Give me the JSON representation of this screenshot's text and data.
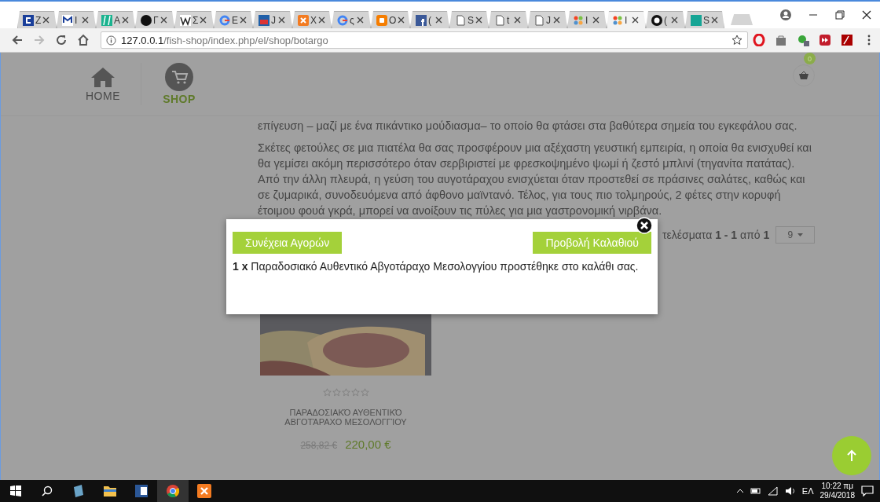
{
  "browser": {
    "tabs": [
      {
        "kind": "c",
        "title": "Ζ",
        "selected": false
      },
      {
        "kind": "m",
        "title": "Ι",
        "selected": false
      },
      {
        "kind": "bars",
        "title": "Α",
        "selected": false
      },
      {
        "kind": "dot",
        "title": "Γ",
        "selected": false
      },
      {
        "kind": "w",
        "title": "Σ",
        "selected": false
      },
      {
        "kind": "g",
        "title": "Ε",
        "selected": false
      },
      {
        "kind": "jnet",
        "title": "J",
        "selected": false
      },
      {
        "kind": "xampp",
        "title": "Χ",
        "selected": false
      },
      {
        "kind": "g",
        "title": "ς",
        "selected": false
      },
      {
        "kind": "blogger",
        "title": "Ο",
        "selected": false
      },
      {
        "kind": "facebook",
        "title": "(",
        "selected": false
      },
      {
        "kind": "doc",
        "title": "S",
        "selected": false
      },
      {
        "kind": "doc",
        "title": "t",
        "selected": false
      },
      {
        "kind": "doc",
        "title": "J",
        "selected": false
      },
      {
        "kind": "joomla",
        "title": "Ι",
        "selected": false
      },
      {
        "kind": "joomla",
        "title": "Ι",
        "selected": true
      },
      {
        "kind": "github",
        "title": "(",
        "selected": false
      },
      {
        "kind": "square",
        "title": "S",
        "selected": false
      }
    ],
    "address": {
      "host": "127.0.0.1",
      "path": "/fish-shop/index.php/el/shop/botargo"
    }
  },
  "nav": [
    {
      "label": "HOME",
      "kind": "home",
      "selected": false
    },
    {
      "label": "SHOP",
      "kind": "cart",
      "selected": true
    }
  ],
  "cart_count": "0",
  "description": [
    "επίγευση – μαζί με ένα πικάντικο μούδιασμα– το οποίο θα φτάσει στα βαθύτερα σημεία του εγκεφάλου σας.",
    "Σκέτες φετούλες σε μια πιατέλα θα σας προσφέρουν μια αξέχαστη γευστική εμπειρία, η οποία θα ενισχυθεί και θα γεμίσει ακόμη περισσότερο όταν σερβιριστεί με φρεσκοψημένο ψωμί ή ζεστό μπλινί (τηγανίτα πατάτας). Από την άλλη πλευρά, η γεύση του αυγοτάραχου ενισχύεται όταν προστεθεί σε πράσινες σαλάτες, καθώς και σε ζυμαρικά, συνοδευόμενα από άφθονο μαϊντανό. Τέλος, για τους πιο τολμηρούς, 2 φέτες στην κορυφή έτοιμου φουά γκρά, μπορεί να ανοίξουν τις πύλες για μια γαστρονομική νιρβάνα."
  ],
  "results": {
    "text": "τελέσματα **1 - 1** από **1**",
    "per_page": "9"
  },
  "product": {
    "name": "ΠΑΡΑΔΟΣΙΑΚΌ ΑΥΘΕΝΤΙΚΌ ΑΒΓΟΤΆΡΑΧΟ ΜΕΣΟΛΟΓΓΊΟΥ",
    "old_price": "258,82 €",
    "price": "220,00 €",
    "stars": 0
  },
  "dialog": {
    "continue_button": "Συνέχεια Αγορών",
    "cart_button": "Προβολή Καλαθιού",
    "message": "**1 x** Παραδοσιακό Αυθεντικό Αβγοτάραχο Μεσολογγίου προστέθηκε στο καλάθι σας."
  },
  "taskbar": {
    "language": "ΕΛ",
    "time": "10:22 πμ",
    "date": "29/4/2018"
  }
}
